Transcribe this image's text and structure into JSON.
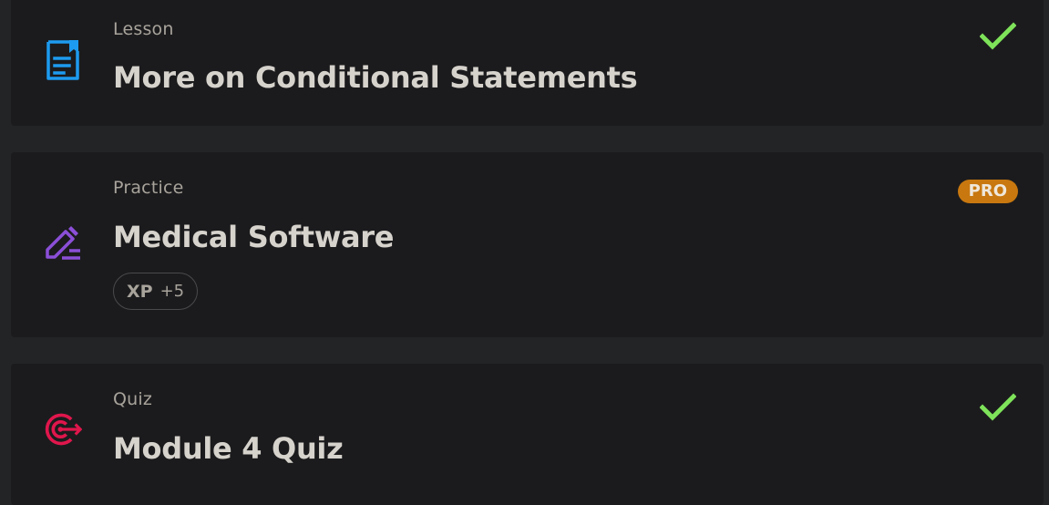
{
  "items": [
    {
      "type_label": "Lesson",
      "title": "More on Conditional Statements",
      "icon": "lesson-document-icon",
      "icon_color": "#1d9bf0",
      "completed": true
    },
    {
      "type_label": "Practice",
      "title": "Medical Software",
      "icon": "practice-pencil-icon",
      "icon_color": "#8b4fd8",
      "badge": "PRO",
      "badge_color": "#c8780f",
      "xp_label": "XP",
      "xp_value": "+5"
    },
    {
      "type_label": "Quiz",
      "title": "Module 4 Quiz",
      "icon": "quiz-target-icon",
      "icon_color": "#e0164c",
      "completed": true
    }
  ],
  "check_color": "#7ee35a",
  "background": "#232426",
  "card_background": "#1b1b1d"
}
